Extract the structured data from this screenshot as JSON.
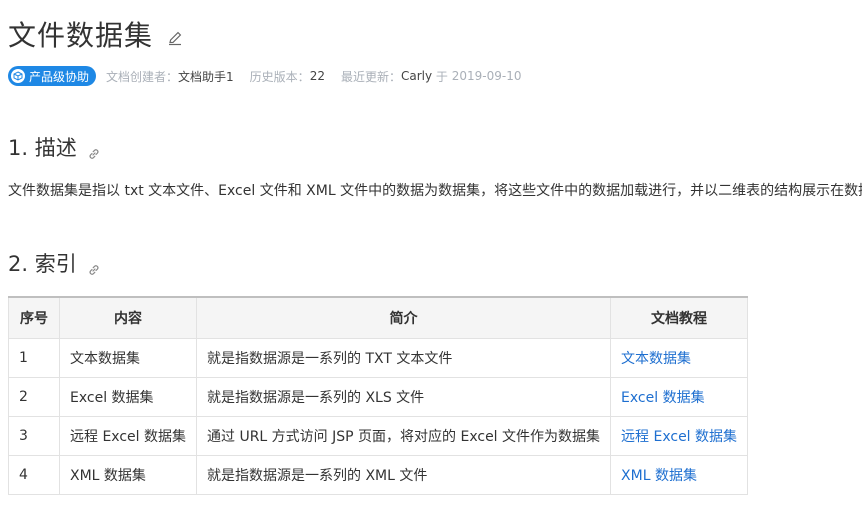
{
  "page": {
    "title": "文件数据集",
    "badge": "产品级协助",
    "creator_label": "文档创建者：",
    "creator": "文档助手1",
    "version_label": "历史版本：",
    "version": "22",
    "updated_label": "最近更新：",
    "updated_by": "Carly",
    "updated_sep": " 于 ",
    "updated_date": "2019-09-10"
  },
  "section1": {
    "heading": "1. 描述",
    "text": "文件数据集是指以 txt 文本文件、Excel 文件和 XML 文件中的数据为数据集，将这些文件中的数据加载进行，并以二维表的结构展示在数据"
  },
  "section2": {
    "heading": "2. 索引",
    "columns": [
      "序号",
      "内容",
      "简介",
      "文档教程"
    ],
    "rows": [
      {
        "no": "1",
        "content": "文本数据集",
        "intro": "就是指数据源是一系列的 TXT 文本文件",
        "doc": "文本数据集"
      },
      {
        "no": "2",
        "content": "Excel 数据集",
        "intro": "就是指数据源是一系列的 XLS 文件",
        "doc": "Excel 数据集"
      },
      {
        "no": "3",
        "content": "远程 Excel 数据集",
        "intro": "通过 URL 方式访问 JSP 页面，将对应的 Excel 文件作为数据集",
        "doc": "远程 Excel 数据集"
      },
      {
        "no": "4",
        "content": "XML 数据集",
        "intro": "就是指数据源是一系列的 XML 文件",
        "doc": "XML 数据集"
      }
    ]
  },
  "colors": {
    "accent": "#1e88e5",
    "link": "#1e6fd0",
    "muted": "#aab0b8"
  },
  "icons": {
    "edit": "pencil-icon",
    "anchor": "link-icon",
    "badge": "cube-icon"
  }
}
